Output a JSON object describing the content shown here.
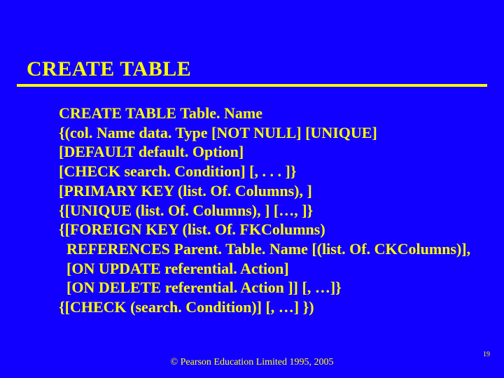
{
  "title": "CREATE TABLE",
  "lines": [
    "CREATE TABLE Table. Name",
    "{(col. Name data. Type [NOT NULL] [UNIQUE]",
    "[DEFAULT default. Option]",
    "[CHECK search. Condition] [, . . . ]}",
    "[PRIMARY KEY (list. Of. Columns), ]",
    "{[UNIQUE (list. Of. Columns), ] […, ]}",
    "{[FOREIGN KEY (list. Of. FKColumns)",
    "  REFERENCES Parent. Table. Name [(list. Of. CKColumns)],",
    "  [ON UPDATE referential. Action]",
    "  [ON DELETE referential. Action ]] [, …]}",
    "{[CHECK (search. Condition)] [, …] })"
  ],
  "footer": "© Pearson Education Limited 1995, 2005",
  "page": "19"
}
